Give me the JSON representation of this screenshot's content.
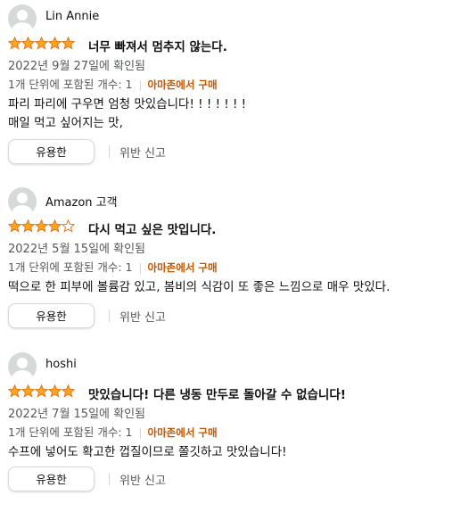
{
  "colors": {
    "star": "#ffa41c",
    "star_empty": "#ffffff",
    "star_outline": "#de7921",
    "verified": "#c45500"
  },
  "reviews": [
    {
      "name": "Lin Annie",
      "rating": 5,
      "title": "너무 빠져서 멈추지 않는다.",
      "date": "2022년 9월 27일에 확인됨",
      "variant": "1개 단위에 포함된 개수: 1",
      "verified": "아마존에서 구매",
      "text": [
        "파리 파리에 구우면 엄청 맛있습니다! ! ! ! ! ! !",
        "매일 먹고 싶어지는 맛,"
      ],
      "helpful": "유용한",
      "report": "위반 신고"
    },
    {
      "name": "Amazon 고객",
      "rating": 4,
      "title": "다시 먹고 싶은 맛입니다.",
      "date": "2022년 5월 15일에 확인됨",
      "variant": "1개 단위에 포함된 개수: 1",
      "verified": "아마존에서 구매",
      "text": [
        "떡으로 한 피부에 볼륨감 있고, 봄비의 식감이 또 좋은 느낌으로 매우 맛있다."
      ],
      "helpful": "유용한",
      "report": "위반 신고"
    },
    {
      "name": "hoshi",
      "rating": 5,
      "title": "맛있습니다! 다른 냉동 만두로 돌아갈 수 없습니다!",
      "date": "2022년 7월 15일에 확인됨",
      "variant": "1개 단위에 포함된 개수: 1",
      "verified": "아마존에서 구매",
      "text": [
        "수프에 넣어도 확고한 껍질이므로 쫄깃하고 맛있습니다!"
      ],
      "helpful": "유용한",
      "report": "위반 신고"
    }
  ]
}
